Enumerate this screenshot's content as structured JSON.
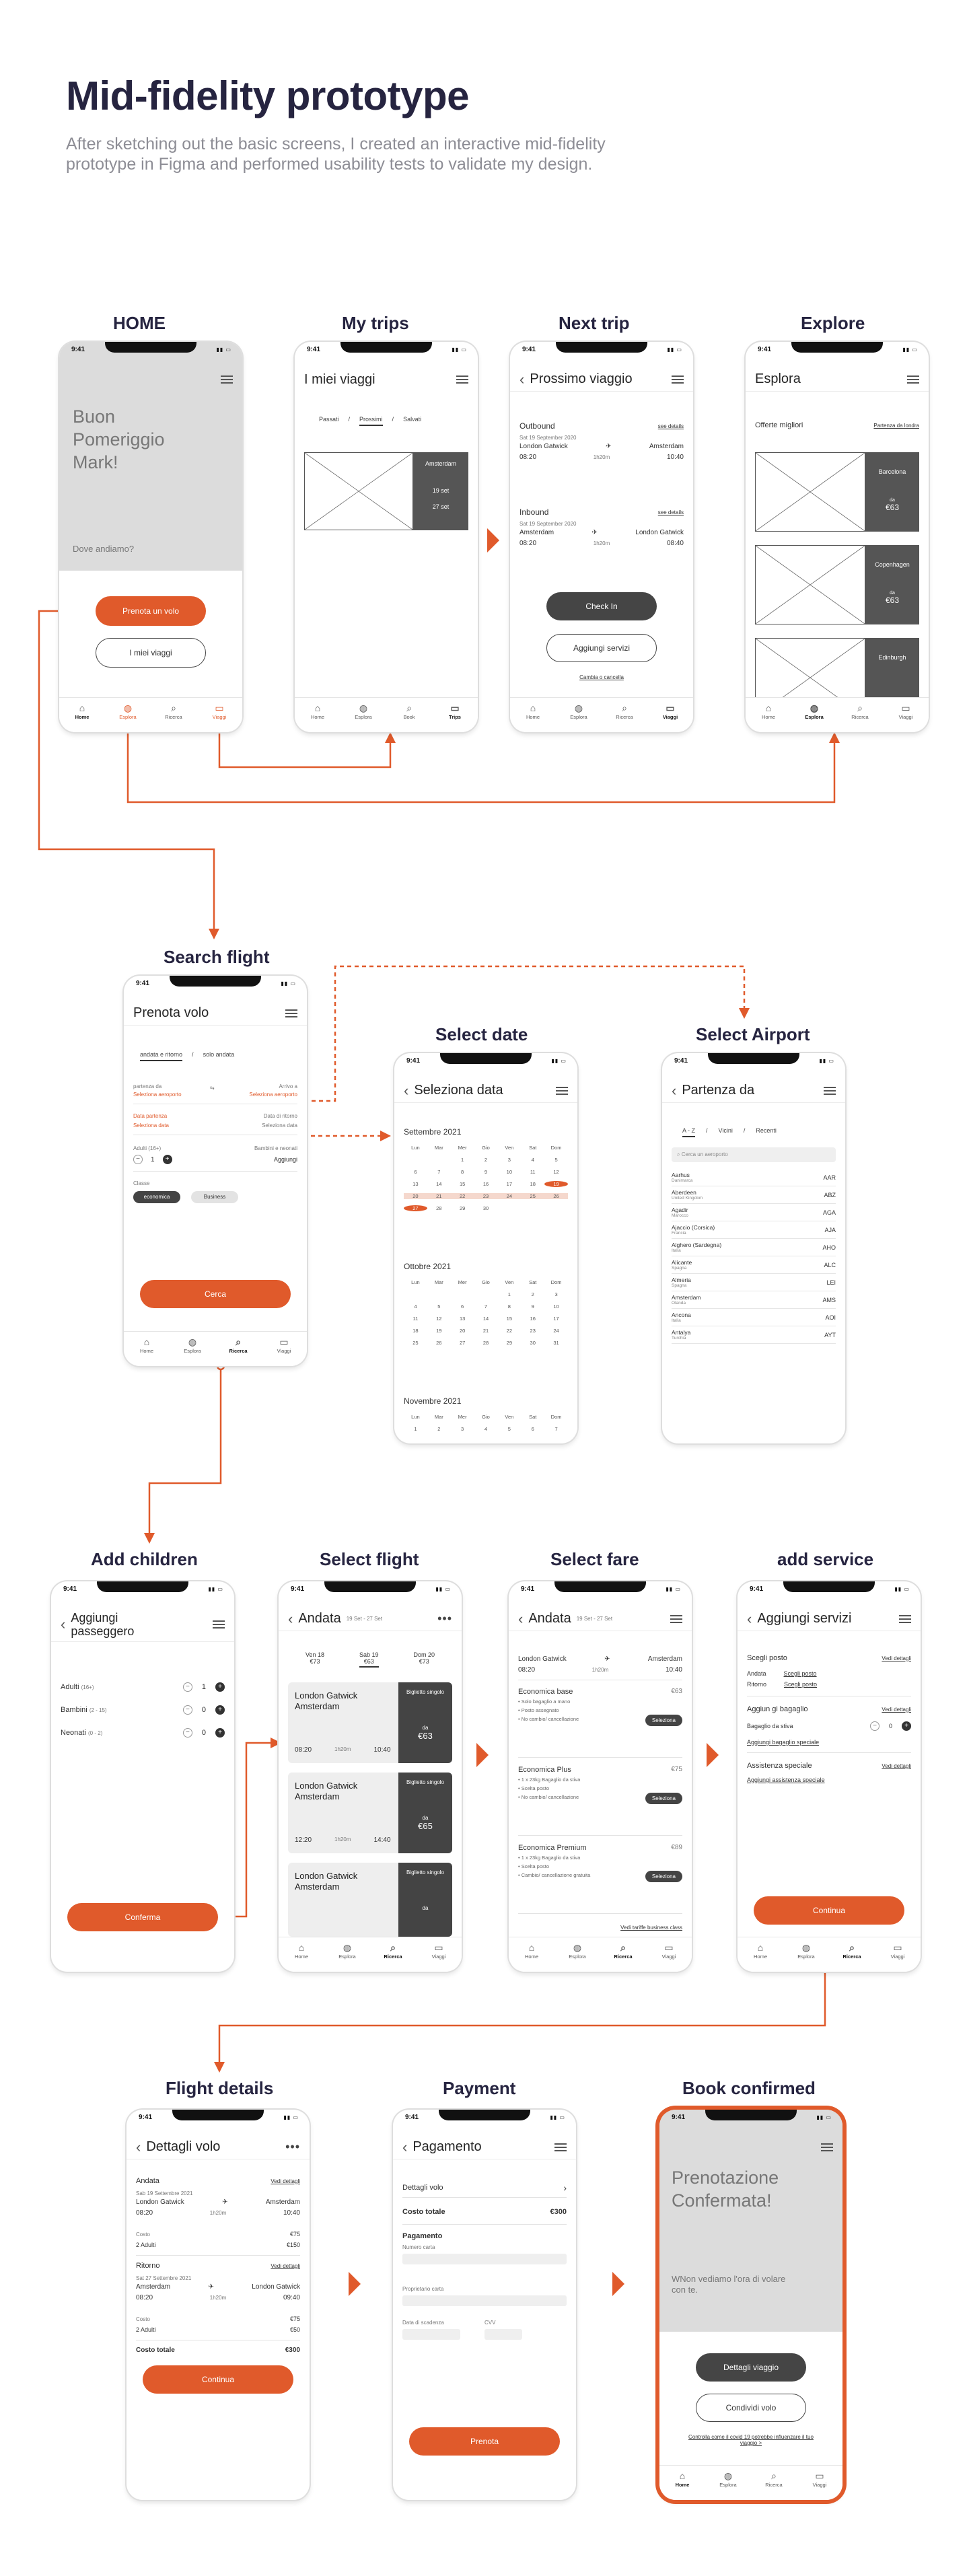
{
  "header": {
    "title": "Mid-fidelity prototype",
    "description": "After sketching out the basic screens, I created an interactive mid-fidelity prototype in Figma and performed usability tests to validate my design."
  },
  "labels": {
    "home": "HOME",
    "trips": "My trips",
    "next": "Next trip",
    "explore": "Explore",
    "search": "Search flight",
    "date": "Select date",
    "airport": "Select Airport",
    "children": "Add children",
    "selflight": "Select flight",
    "fare": "Select fare",
    "service": "add service",
    "details": "Flight details",
    "payment": "Payment",
    "confirmed": "Book confirmed"
  },
  "status": {
    "time": "9:41"
  },
  "nav": {
    "home": "Home",
    "explore": "Esplora",
    "search": "Ricerca",
    "trips": "Viaggi",
    "trips2": "Trips",
    "book": "Book",
    "cerca": "Cerca"
  },
  "s_home": {
    "greeting": "Buon Pomeriggio Mark!",
    "question": "Dove andiamo?",
    "book_btn": "Prenota un volo",
    "trips_btn": "I miei viaggi"
  },
  "s_trips": {
    "title": "I miei viaggi",
    "tabs": [
      "Passati",
      "Prossimi",
      "Salvati"
    ],
    "city": "Amsterdam",
    "date1": "19 set",
    "date2": "27 set"
  },
  "s_next": {
    "title": "Prossimo viaggio",
    "outbound": "Outbound",
    "inbound": "Inbound",
    "see": "see details",
    "date_out": "Sat 19 September 2020",
    "date_in": "Sat 19 September 2020",
    "from": "London Gatwick",
    "to": "Amsterdam",
    "t1": "08:20",
    "dur": "1h20m",
    "t2": "10:40",
    "from2": "Amsterdam",
    "to2": "London Gatwick",
    "t3": "08:20",
    "t4": "08:40",
    "checkin": "Check In",
    "services": "Aggiungi servizi",
    "change": "Cambia o cancella"
  },
  "s_explore": {
    "title": "Esplora",
    "offers": "Offerte migliori",
    "from_link": "Partenza da londra",
    "cities": [
      "Barcelona",
      "Copenhagen",
      "Edinburgh"
    ],
    "da": "da",
    "price": "€63"
  },
  "s_search": {
    "title": "Prenota volo",
    "trip_a": "andata e ritorno",
    "trip_b": "solo andata",
    "dep_lbl": "partenza da",
    "dep_val": "Seleziona aeroporto",
    "arr_lbl": "Arrivo a",
    "arr_val": "Seleziona aeroporto",
    "date_lbl": "Data partenza",
    "date_val": "Seleziona data",
    "ret_lbl": "Data di ritorno",
    "ret_val": "Seleziona data",
    "adults_lbl": "Adulti (16+)",
    "adults": "1",
    "kids_lbl": "Bambini e neonati",
    "kids_val": "Aggiungi",
    "class_lbl": "Classe",
    "class_a": "economica",
    "class_b": "Business",
    "cta": "Cerca"
  },
  "s_date": {
    "title": "Seleziona data",
    "month1": "Settembre 2021",
    "month2": "Ottobre 2021",
    "month3": "Novembre 2021",
    "days": [
      "Lun",
      "Mar",
      "Mer",
      "Gio",
      "Ven",
      "Sat",
      "Dom"
    ],
    "sep": [
      "",
      "",
      "1",
      "2",
      "3",
      "4",
      "5",
      "6",
      "7",
      "8",
      "9",
      "10",
      "11",
      "12",
      "13",
      "14",
      "15",
      "16",
      "17",
      "18",
      "19",
      "20",
      "21",
      "22",
      "23",
      "24",
      "25",
      "26",
      "27",
      "28",
      "29",
      "30"
    ],
    "oct": [
      "",
      "",
      "",
      "",
      "1",
      "2",
      "3",
      "4",
      "5",
      "6",
      "7",
      "8",
      "9",
      "10",
      "11",
      "12",
      "13",
      "14",
      "15",
      "16",
      "17",
      "18",
      "19",
      "20",
      "21",
      "22",
      "23",
      "24",
      "25",
      "26",
      "27",
      "28",
      "29",
      "30",
      "31"
    ],
    "nov": [
      "1",
      "2",
      "3",
      "4",
      "5",
      "6",
      "7"
    ]
  },
  "s_airport": {
    "title": "Partenza da",
    "tabs": [
      "A - Z",
      "Vicini",
      "Recenti"
    ],
    "search": "Cerca un aeroporto",
    "items": [
      {
        "n": "Aarhus",
        "c": "Danimarca",
        "k": "AAR"
      },
      {
        "n": "Aberdeen",
        "c": "United Kingdom",
        "k": "ABZ"
      },
      {
        "n": "Agadir",
        "c": "Marocco",
        "k": "AGA"
      },
      {
        "n": "Ajaccio (Corsica)",
        "c": "Francia",
        "k": "AJA"
      },
      {
        "n": "Alghero (Sardegna)",
        "c": "Italia",
        "k": "AHO"
      },
      {
        "n": "Alicante",
        "c": "Spagna",
        "k": "ALC"
      },
      {
        "n": "Almeria",
        "c": "Spagna",
        "k": "LEI"
      },
      {
        "n": "Amsterdam",
        "c": "Olanda",
        "k": "AMS"
      },
      {
        "n": "Ancona",
        "c": "Italia",
        "k": "AOI"
      },
      {
        "n": "Antalya",
        "c": "Turchia",
        "k": "AYT"
      }
    ]
  },
  "s_children": {
    "title": "Aggiungi passeggero",
    "rows": [
      {
        "l": "Adulti",
        "s": "(16+)",
        "v": "1"
      },
      {
        "l": "Bambini",
        "s": "(2 - 15)",
        "v": "0"
      },
      {
        "l": "Neonati",
        "s": "(0 - 2)",
        "v": "0"
      }
    ],
    "cta": "Conferma"
  },
  "s_flight": {
    "title": "Andata",
    "sub": "19 Set - 27 Set",
    "dates": [
      {
        "d": "Ven 18",
        "p": "€73"
      },
      {
        "d": "Sab 19",
        "p": "€63"
      },
      {
        "d": "Dom 20",
        "p": "€73"
      }
    ],
    "cards": [
      {
        "from": "London Gatwick",
        "to": "Amsterdam",
        "t1": "08:20",
        "t2": "10:40",
        "p": "€63",
        "tag": "Biglietto singolo"
      },
      {
        "from": "London Gatwick",
        "to": "Amsterdam",
        "t1": "12:20",
        "t2": "14:40",
        "p": "€65",
        "tag": "Biglietto singolo"
      },
      {
        "from": "London Gatwick",
        "to": "Amsterdam",
        "t1": "",
        "t2": "",
        "p": "",
        "tag": "Biglietto singolo"
      }
    ],
    "dur": "1h20m",
    "da": "da"
  },
  "s_fare": {
    "title": "Andata",
    "sub": "19 Set - 27 Set",
    "from": "London Gatwick",
    "to": "Amsterdam",
    "t1": "08:20",
    "dur": "1h20m",
    "t2": "10:40",
    "fares": [
      {
        "n": "Economica base",
        "p": "€63",
        "f": [
          "Solo bagaglio a mano",
          "Posto assegnato",
          "No cambio/ cancellazione"
        ]
      },
      {
        "n": "Economica Plus",
        "p": "€75",
        "f": [
          "1 x 23kg Bagaglio da stiva",
          "Scelta posto",
          "No cambio/ cancellazione"
        ]
      },
      {
        "n": "Economica Premium",
        "p": "€89",
        "f": [
          "1 x 23kg Bagaglio da stiva",
          "Scelta posto",
          "Cambio/ cancellazione gratuita"
        ]
      }
    ],
    "sel": "Seleziona",
    "link": "Vedi tariffe business class"
  },
  "s_service": {
    "title": "Aggiungi servizi",
    "seat": "Scegli posto",
    "details": "Vedi dettagli",
    "andata": "Andata",
    "ritorno": "Ritorno",
    "choose": "Scegli posto",
    "bag": "Aggiun gi bagaglio",
    "bag_lbl": "Bagaglio da stiva",
    "bag_val": "0",
    "bag_link": "Aggiungi bagaglio speciale",
    "assist": "Assistenza speciale",
    "assist_link": "Aggiungi assistenza speciale",
    "cta": "Continua"
  },
  "s_details": {
    "title": "Dettagli volo",
    "andata": "Andata",
    "ritorno": "Ritorno",
    "see": "Vedi dettagli",
    "d1": "Sab 19 Settembre 2021",
    "d2": "Sat 27 Settembre 2021",
    "from": "London Gatwick",
    "to": "Amsterdam",
    "t1": "08:20",
    "dur": "1h20m",
    "t2": "10:40",
    "t3": "08:20",
    "t4": "09:40",
    "costo": "Costo",
    "c1": "€75",
    "adulti": "2 Adulti",
    "c2": "€150",
    "c3": "€75",
    "c4": "€50",
    "total_lbl": "Costo totale",
    "total": "€300",
    "cta": "Continua"
  },
  "s_payment": {
    "title": "Pagamento",
    "det": "Dettagli volo",
    "total_lbl": "Costo totale",
    "total": "€300",
    "pay": "Pagamento",
    "card": "Numero carta",
    "owner": "Proprietario carta",
    "exp": "Data di scadenza",
    "cvv": "CVV",
    "cta": "Prenota"
  },
  "s_confirm": {
    "title": "Prenotazione Confermata!",
    "sub": "WNon vediamo l'ora di volare con te.",
    "btn1": "Dettagli viaggio",
    "btn2": "Condividi volo",
    "note": "Controlla come il covid 19 potrebbe influenzare il tuo viaggio >"
  },
  "colors": {
    "accent": "#e05a2b",
    "dark": "#262440"
  }
}
